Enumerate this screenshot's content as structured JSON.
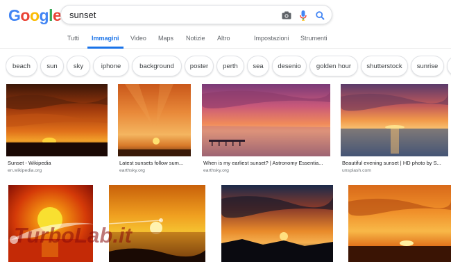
{
  "logo": {
    "letters": [
      "G",
      "o",
      "o",
      "g",
      "l",
      "e"
    ],
    "colors": [
      "#4285F4",
      "#EA4335",
      "#FBBC05",
      "#4285F4",
      "#34A853",
      "#EA4335"
    ]
  },
  "search": {
    "value": "sunset",
    "icons": [
      "camera-icon",
      "mic-icon",
      "search-icon"
    ]
  },
  "nav": {
    "tabs": [
      {
        "label": "Tutti",
        "active": false
      },
      {
        "label": "Immagini",
        "active": true
      },
      {
        "label": "Video",
        "active": false
      },
      {
        "label": "Maps",
        "active": false
      },
      {
        "label": "Notizie",
        "active": false
      },
      {
        "label": "Altro",
        "active": false
      },
      {
        "label": "Impostazioni",
        "active": false
      },
      {
        "label": "Strumenti",
        "active": false
      }
    ]
  },
  "chips": [
    "beach",
    "sun",
    "sky",
    "iphone",
    "background",
    "poster",
    "perth",
    "sea",
    "desenio",
    "golden hour",
    "shutterstock",
    "sunrise"
  ],
  "results": [
    {
      "title": "Sunset - Wikipedia",
      "domain": "en.wikipedia.org"
    },
    {
      "title": "Latest sunsets follow sum...",
      "domain": "earthsky.org"
    },
    {
      "title": "When is my earliest sunset? | Astronomy Essentia...",
      "domain": "earthsky.org"
    },
    {
      "title": "Beautiful evening sunset | HD photo by S...",
      "domain": "unsplash.com"
    }
  ],
  "watermark": {
    "text": "TurboLab.it"
  },
  "colors": {
    "accent": "#1a73e8",
    "chip_border": "#dfe1e5"
  }
}
